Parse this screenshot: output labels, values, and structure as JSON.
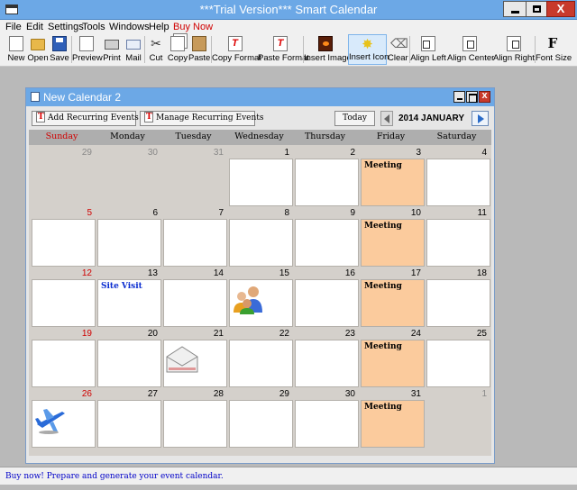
{
  "window": {
    "title": "***Trial Version*** Smart Calendar",
    "close_glyph": "X"
  },
  "menu": [
    "File",
    "Edit",
    "Settings",
    "Tools",
    "Windows",
    "Help",
    "Buy Now"
  ],
  "toolbar": {
    "buttons": [
      {
        "label": "New",
        "icon": "new-document-icon"
      },
      {
        "label": "Open",
        "icon": "folder-icon"
      },
      {
        "label": "Save",
        "icon": "floppy-disk-icon"
      },
      {
        "label": "Preview",
        "icon": "print-preview-icon"
      },
      {
        "label": "Print",
        "icon": "printer-icon"
      },
      {
        "label": "Mail",
        "icon": "mail-icon"
      },
      {
        "label": "Cut",
        "icon": "scissors-icon"
      },
      {
        "label": "Copy",
        "icon": "copy-icon"
      },
      {
        "label": "Paste",
        "icon": "paste-icon"
      },
      {
        "label": "Copy Format",
        "icon": "copy-format-icon"
      },
      {
        "label": "Paste Format",
        "icon": "paste-format-icon"
      },
      {
        "label": "Insert Image",
        "icon": "insert-image-icon"
      },
      {
        "label": "Insert Icon",
        "icon": "insert-icon-icon"
      },
      {
        "label": "Clear",
        "icon": "broom-icon"
      },
      {
        "label": "Align Left",
        "icon": "align-left-icon"
      },
      {
        "label": "Align Center",
        "icon": "align-center-icon"
      },
      {
        "label": "Align Right",
        "icon": "align-right-icon"
      },
      {
        "label": "Font Size",
        "icon": "font-size-icon"
      }
    ],
    "active": "Insert Icon"
  },
  "calendar_window": {
    "title": "New Calendar 2",
    "close_glyph": "x",
    "add_recurring": "Add Recurring Events",
    "manage_recurring": "Manage Recurring Events",
    "today": "Today",
    "month_label": "2014 JANUARY",
    "weekdays": [
      "Sunday",
      "Monday",
      "Tuesday",
      "Wednesday",
      "Thursday",
      "Friday",
      "Saturday"
    ],
    "weeks": [
      [
        {
          "d": "29",
          "other": true
        },
        {
          "d": "30",
          "other": true
        },
        {
          "d": "31",
          "other": true
        },
        {
          "d": "1"
        },
        {
          "d": "2"
        },
        {
          "d": "3",
          "event": "Meeting",
          "meet": true
        },
        {
          "d": "4"
        }
      ],
      [
        {
          "d": "5"
        },
        {
          "d": "6"
        },
        {
          "d": "7"
        },
        {
          "d": "8"
        },
        {
          "d": "9"
        },
        {
          "d": "10",
          "event": "Meeting",
          "meet": true
        },
        {
          "d": "11"
        }
      ],
      [
        {
          "d": "12"
        },
        {
          "d": "13",
          "event": "Site Visit",
          "blue": true
        },
        {
          "d": "14"
        },
        {
          "d": "15",
          "icon": "people-icon"
        },
        {
          "d": "16"
        },
        {
          "d": "17",
          "event": "Meeting",
          "meet": true
        },
        {
          "d": "18"
        }
      ],
      [
        {
          "d": "19"
        },
        {
          "d": "20"
        },
        {
          "d": "21",
          "icon": "envelope-icon"
        },
        {
          "d": "22"
        },
        {
          "d": "23"
        },
        {
          "d": "24",
          "event": "Meeting",
          "meet": true
        },
        {
          "d": "25"
        }
      ],
      [
        {
          "d": "26",
          "icon": "airplane-icon"
        },
        {
          "d": "27"
        },
        {
          "d": "28"
        },
        {
          "d": "29"
        },
        {
          "d": "30"
        },
        {
          "d": "31",
          "event": "Meeting",
          "meet": true
        },
        {
          "d": "1",
          "other": true
        }
      ]
    ]
  },
  "status": "Buy now! Prepare and generate your event calendar.",
  "colors": {
    "titlebar": "#6ca8e6",
    "meeting": "#fbcb9d",
    "sunday": "#d00000",
    "site_visit": "#0a2cd0"
  }
}
